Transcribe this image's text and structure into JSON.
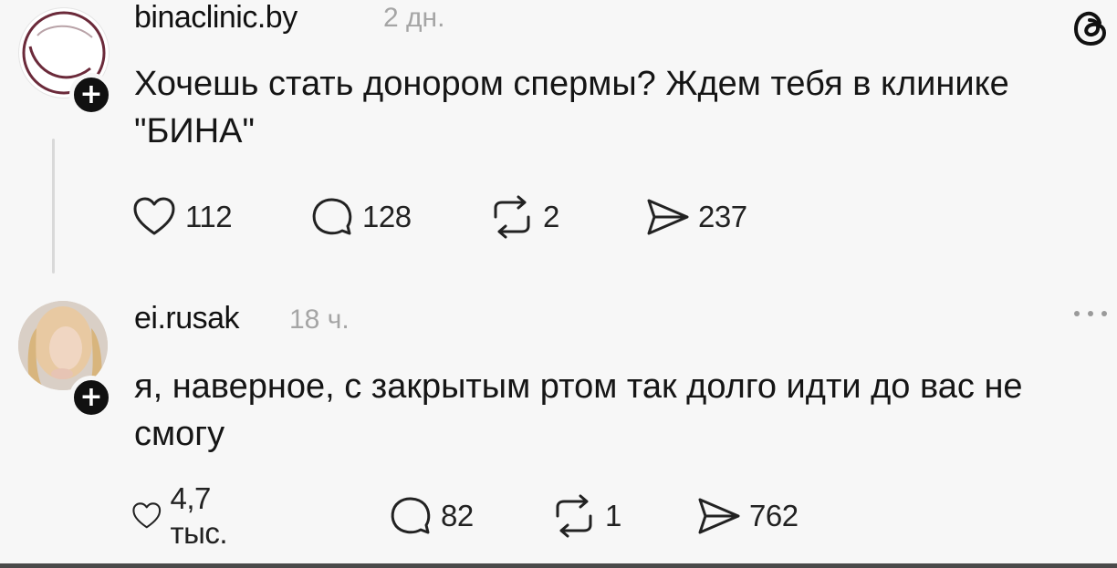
{
  "posts": [
    {
      "username": "binaclinic.by",
      "time": "2 дн.",
      "text": "Хочешь стать донором спермы? Ждем тебя в клинике \"БИНА\"",
      "likes": "112",
      "comments": "128",
      "reposts": "2",
      "shares": "237"
    },
    {
      "username": "ei.rusak",
      "time": "18 ч.",
      "text": "я, наверное, с закрытым ртом так долго идти до вас не смогу",
      "likes": "4,7 тыс.",
      "comments": "82",
      "reposts": "1",
      "shares": "762"
    }
  ],
  "icons": {
    "follow": "+",
    "logo": "threads-logo-icon",
    "more": "more-icon"
  },
  "colors": {
    "background": "#f7f7f7",
    "text": "#151515",
    "muted": "#a5a5a5",
    "logo_ring": "#6b2a3a"
  }
}
